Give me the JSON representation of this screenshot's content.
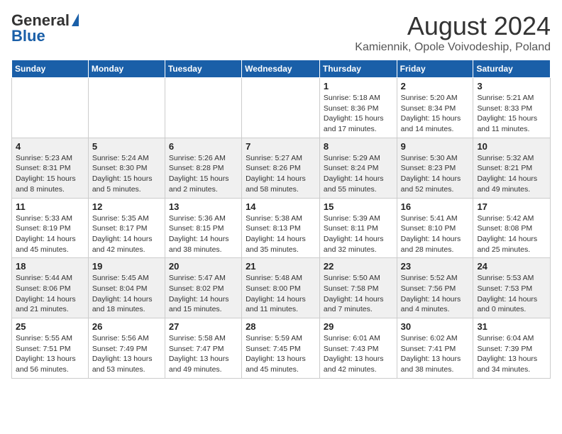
{
  "header": {
    "logo_general": "General",
    "logo_blue": "Blue",
    "title": "August 2024",
    "subtitle": "Kamiennik, Opole Voivodeship, Poland"
  },
  "weekdays": [
    "Sunday",
    "Monday",
    "Tuesday",
    "Wednesday",
    "Thursday",
    "Friday",
    "Saturday"
  ],
  "weeks": [
    [
      {
        "day": "",
        "info": ""
      },
      {
        "day": "",
        "info": ""
      },
      {
        "day": "",
        "info": ""
      },
      {
        "day": "",
        "info": ""
      },
      {
        "day": "1",
        "info": "Sunrise: 5:18 AM\nSunset: 8:36 PM\nDaylight: 15 hours\nand 17 minutes."
      },
      {
        "day": "2",
        "info": "Sunrise: 5:20 AM\nSunset: 8:34 PM\nDaylight: 15 hours\nand 14 minutes."
      },
      {
        "day": "3",
        "info": "Sunrise: 5:21 AM\nSunset: 8:33 PM\nDaylight: 15 hours\nand 11 minutes."
      }
    ],
    [
      {
        "day": "4",
        "info": "Sunrise: 5:23 AM\nSunset: 8:31 PM\nDaylight: 15 hours\nand 8 minutes."
      },
      {
        "day": "5",
        "info": "Sunrise: 5:24 AM\nSunset: 8:30 PM\nDaylight: 15 hours\nand 5 minutes."
      },
      {
        "day": "6",
        "info": "Sunrise: 5:26 AM\nSunset: 8:28 PM\nDaylight: 15 hours\nand 2 minutes."
      },
      {
        "day": "7",
        "info": "Sunrise: 5:27 AM\nSunset: 8:26 PM\nDaylight: 14 hours\nand 58 minutes."
      },
      {
        "day": "8",
        "info": "Sunrise: 5:29 AM\nSunset: 8:24 PM\nDaylight: 14 hours\nand 55 minutes."
      },
      {
        "day": "9",
        "info": "Sunrise: 5:30 AM\nSunset: 8:23 PM\nDaylight: 14 hours\nand 52 minutes."
      },
      {
        "day": "10",
        "info": "Sunrise: 5:32 AM\nSunset: 8:21 PM\nDaylight: 14 hours\nand 49 minutes."
      }
    ],
    [
      {
        "day": "11",
        "info": "Sunrise: 5:33 AM\nSunset: 8:19 PM\nDaylight: 14 hours\nand 45 minutes."
      },
      {
        "day": "12",
        "info": "Sunrise: 5:35 AM\nSunset: 8:17 PM\nDaylight: 14 hours\nand 42 minutes."
      },
      {
        "day": "13",
        "info": "Sunrise: 5:36 AM\nSunset: 8:15 PM\nDaylight: 14 hours\nand 38 minutes."
      },
      {
        "day": "14",
        "info": "Sunrise: 5:38 AM\nSunset: 8:13 PM\nDaylight: 14 hours\nand 35 minutes."
      },
      {
        "day": "15",
        "info": "Sunrise: 5:39 AM\nSunset: 8:11 PM\nDaylight: 14 hours\nand 32 minutes."
      },
      {
        "day": "16",
        "info": "Sunrise: 5:41 AM\nSunset: 8:10 PM\nDaylight: 14 hours\nand 28 minutes."
      },
      {
        "day": "17",
        "info": "Sunrise: 5:42 AM\nSunset: 8:08 PM\nDaylight: 14 hours\nand 25 minutes."
      }
    ],
    [
      {
        "day": "18",
        "info": "Sunrise: 5:44 AM\nSunset: 8:06 PM\nDaylight: 14 hours\nand 21 minutes."
      },
      {
        "day": "19",
        "info": "Sunrise: 5:45 AM\nSunset: 8:04 PM\nDaylight: 14 hours\nand 18 minutes."
      },
      {
        "day": "20",
        "info": "Sunrise: 5:47 AM\nSunset: 8:02 PM\nDaylight: 14 hours\nand 15 minutes."
      },
      {
        "day": "21",
        "info": "Sunrise: 5:48 AM\nSunset: 8:00 PM\nDaylight: 14 hours\nand 11 minutes."
      },
      {
        "day": "22",
        "info": "Sunrise: 5:50 AM\nSunset: 7:58 PM\nDaylight: 14 hours\nand 7 minutes."
      },
      {
        "day": "23",
        "info": "Sunrise: 5:52 AM\nSunset: 7:56 PM\nDaylight: 14 hours\nand 4 minutes."
      },
      {
        "day": "24",
        "info": "Sunrise: 5:53 AM\nSunset: 7:53 PM\nDaylight: 14 hours\nand 0 minutes."
      }
    ],
    [
      {
        "day": "25",
        "info": "Sunrise: 5:55 AM\nSunset: 7:51 PM\nDaylight: 13 hours\nand 56 minutes."
      },
      {
        "day": "26",
        "info": "Sunrise: 5:56 AM\nSunset: 7:49 PM\nDaylight: 13 hours\nand 53 minutes."
      },
      {
        "day": "27",
        "info": "Sunrise: 5:58 AM\nSunset: 7:47 PM\nDaylight: 13 hours\nand 49 minutes."
      },
      {
        "day": "28",
        "info": "Sunrise: 5:59 AM\nSunset: 7:45 PM\nDaylight: 13 hours\nand 45 minutes."
      },
      {
        "day": "29",
        "info": "Sunrise: 6:01 AM\nSunset: 7:43 PM\nDaylight: 13 hours\nand 42 minutes."
      },
      {
        "day": "30",
        "info": "Sunrise: 6:02 AM\nSunset: 7:41 PM\nDaylight: 13 hours\nand 38 minutes."
      },
      {
        "day": "31",
        "info": "Sunrise: 6:04 AM\nSunset: 7:39 PM\nDaylight: 13 hours\nand 34 minutes."
      }
    ]
  ]
}
